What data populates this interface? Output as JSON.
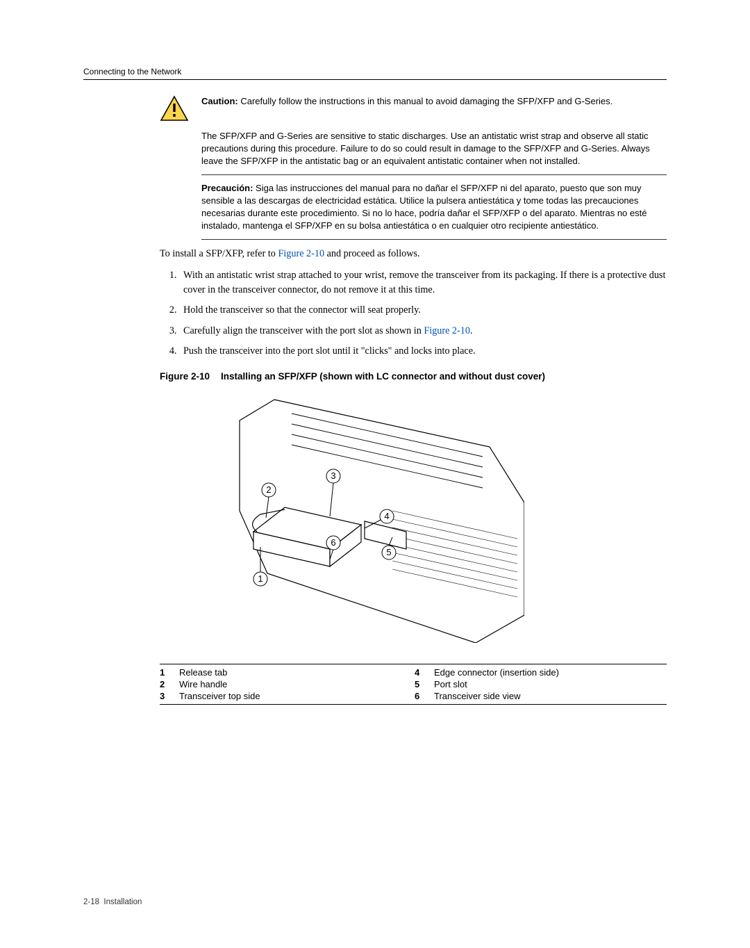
{
  "header": {
    "section": "Connecting to the Network"
  },
  "caution": {
    "label": "Caution:",
    "en1": "Carefully follow the instructions in this manual to avoid damaging the SFP/XFP and G-Series.",
    "en2": "The SFP/XFP and G-Series are sensitive to static discharges. Use an antistatic wrist strap and observe all static precautions during this procedure. Failure to do so could result in damage to the SFP/XFP and G-Series. Always leave the SFP/XFP in the antistatic bag or an equivalent antistatic container when not installed.",
    "es_label": "Precaución:",
    "es": "Siga las instrucciones del manual para no dañar el SFP/XFP ni del aparato, puesto que son muy sensible a las descargas de electricidad estática. Utilice la pulsera antiestática y tome todas las precauciones necesarias durante este procedimiento. Si no lo hace, podría dañar el SFP/XFP o del aparato. Mientras no esté instalado, mantenga el SFP/XFP en su bolsa antiestática o en cualquier otro recipiente antiestático."
  },
  "intro": {
    "pre": "To install a SFP/XFP, refer to ",
    "ref": "Figure 2-10",
    "post": " and proceed as follows."
  },
  "steps": [
    "With an antistatic wrist strap attached to your wrist, remove the transceiver from its packaging. If there is a protective dust cover in the transceiver connector, do not remove it at this time.",
    "Hold the transceiver so that the connector will seat properly."
  ],
  "step3": {
    "pre": "Carefully align the transceiver with the port slot as shown in ",
    "ref": "Figure 2-10",
    "post": "."
  },
  "step4": "Push the transceiver into the port slot until it \"clicks\" and locks into place.",
  "figure": {
    "number": "Figure 2-10",
    "title": "Installing an SFP/XFP (shown with LC connector and without dust cover)"
  },
  "callouts": [
    {
      "n": "1",
      "t": "Release tab"
    },
    {
      "n": "2",
      "t": "Wire handle"
    },
    {
      "n": "3",
      "t": "Transceiver top side"
    },
    {
      "n": "4",
      "t": "Edge connector (insertion side)"
    },
    {
      "n": "5",
      "t": "Port slot"
    },
    {
      "n": "6",
      "t": "Transceiver side view"
    }
  ],
  "footer": {
    "page": "2-18",
    "name": "Installation"
  }
}
